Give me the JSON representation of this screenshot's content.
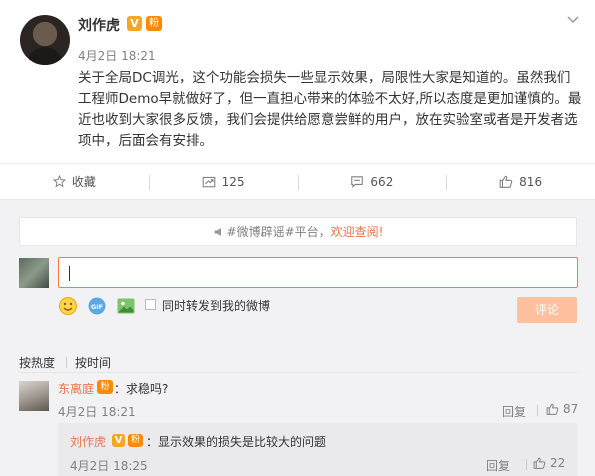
{
  "post": {
    "author": "刘作虎",
    "verified_badge": "V",
    "fan_badge": "粉",
    "time": "4月2日 18:21",
    "more_icon": "chevron-down-icon",
    "content": "关于全局DC调光，这个功能会损失一些显示效果，局限性大家是知道的。虽然我们工程师Demo早就做好了，但一直担心带来的体验不太好,所以态度是更加谨慎的。最近也收到大家很多反馈，我们会提供给愿意尝鲜的用户，放在实验室或者是开发者选项中，后面会有安排。"
  },
  "actions": {
    "favorite": {
      "label": "收藏",
      "icon": "star-icon"
    },
    "repost": {
      "count": "125",
      "icon": "repost-icon"
    },
    "comment": {
      "count": "662",
      "icon": "comment-icon"
    },
    "like": {
      "count": "816",
      "icon": "thumbs-up-icon"
    }
  },
  "comment_composer": {
    "rumor_notice_prefix": "#微博辟谣#平台，",
    "rumor_notice_link": "欢迎查阅!",
    "input_value": "",
    "repost_checkbox_label": "同时转发到我的微博",
    "submit_label": "评论",
    "tool_icons": [
      "emoji-icon",
      "gif-icon",
      "image-icon"
    ]
  },
  "sort": {
    "by_hot": "按热度",
    "by_time": "按时间"
  },
  "comments": [
    {
      "author": "东离庭",
      "fan_badge": "粉",
      "text": "：求稳吗?",
      "time": "4月2日 18:21",
      "reply_label": "回复",
      "likes": "87",
      "replies": [
        {
          "author": "刘作虎",
          "verified_badge": "V",
          "fan_badge": "粉",
          "text": "：显示效果的损失是比较大的问题",
          "time": "4月2日 18:25",
          "reply_label": "回复",
          "likes": "22"
        }
      ]
    }
  ],
  "colors": {
    "accent": "#eb7350",
    "input_border": "#fa7d3c",
    "submit_disabled": "#ffc09f",
    "badge_gold": "#f5a623"
  }
}
